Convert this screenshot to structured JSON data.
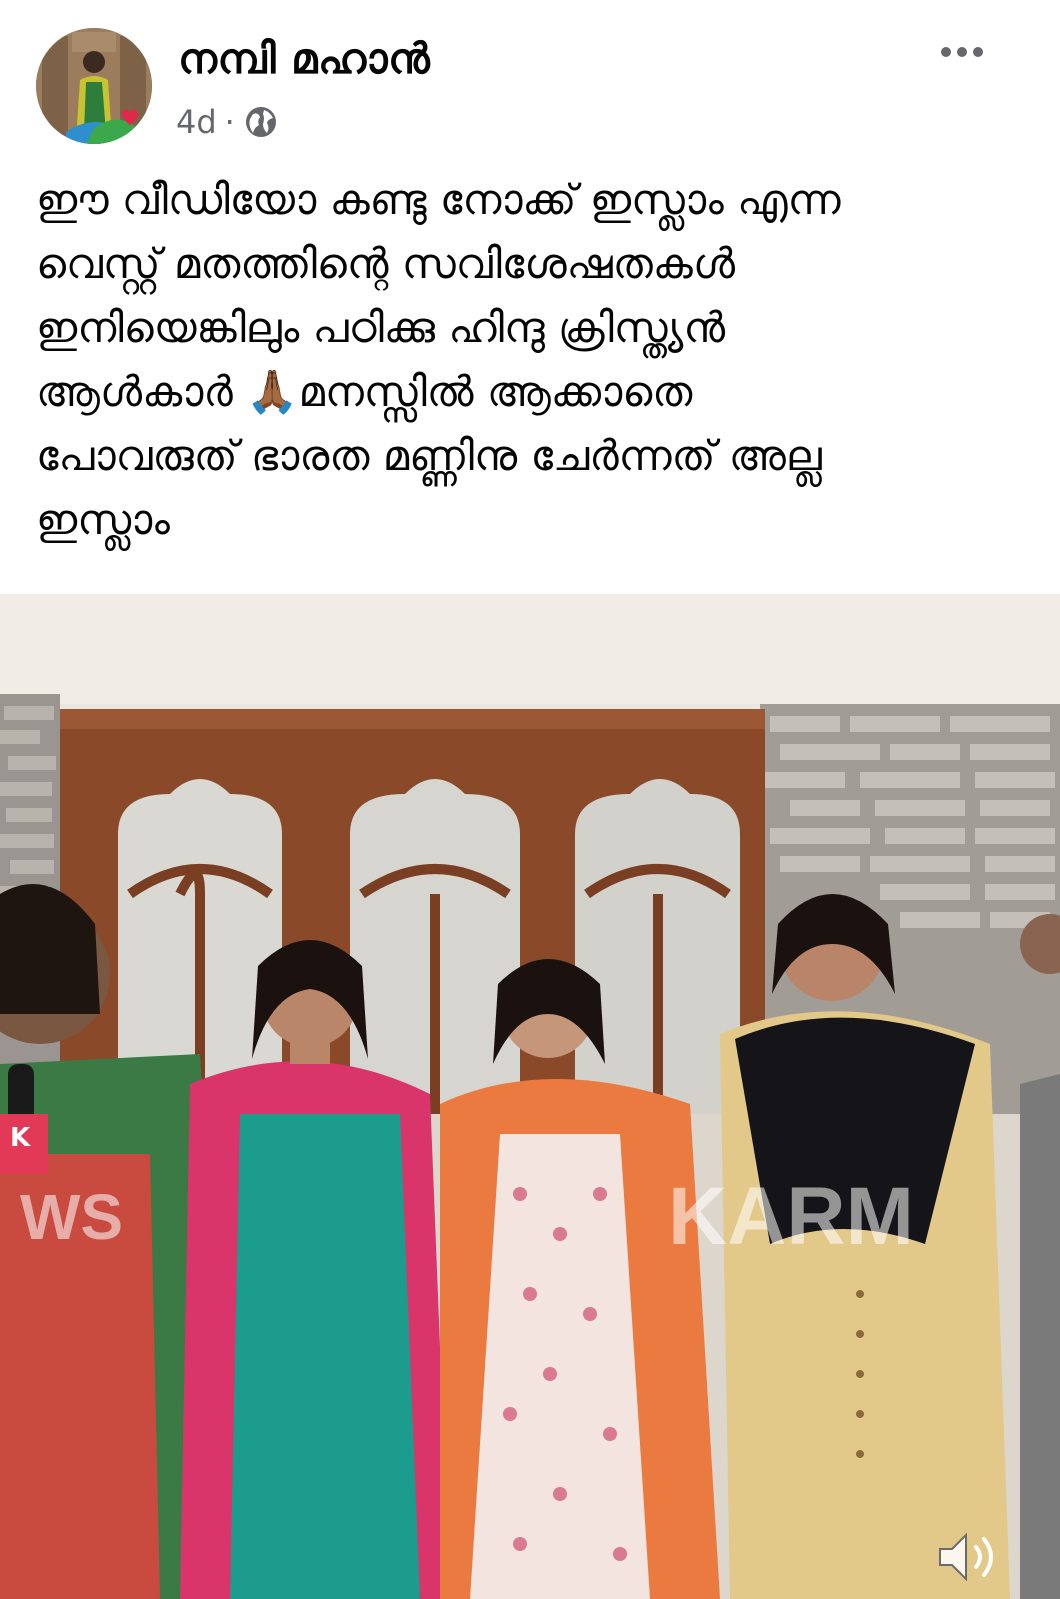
{
  "post": {
    "author": "നമ്പി മഹാൻ",
    "time": "4d",
    "separator": "·",
    "privacy_icon": "globe-icon",
    "more_icon": "more-dots-icon",
    "text": "ഈ വീഡിയോ കണ്ടു നോക്ക് ഇസ്ലാം എന്ന\nവെസ്റ്റ് മതത്തിന്റെ സവിശേഷതകൾ\nഇനിയെങ്കിലും പഠിക്കു ഹിന്ദു ക്രിസ്ത്യൻ\nആൾകാർ 🙏🏾മനസ്സിൽ ആക്കാതെ\nപോവരുത് ഭാരത മണ്ണിനു ചേർന്നത് അല്ല\nഇസ്ലാം"
  },
  "video": {
    "watermark_left": "WS",
    "watermark_right": "KARM",
    "mic_logo": "K",
    "mute_icon": "speaker-icon"
  },
  "colors": {
    "text": "#050505",
    "secondary": "#65676b"
  }
}
